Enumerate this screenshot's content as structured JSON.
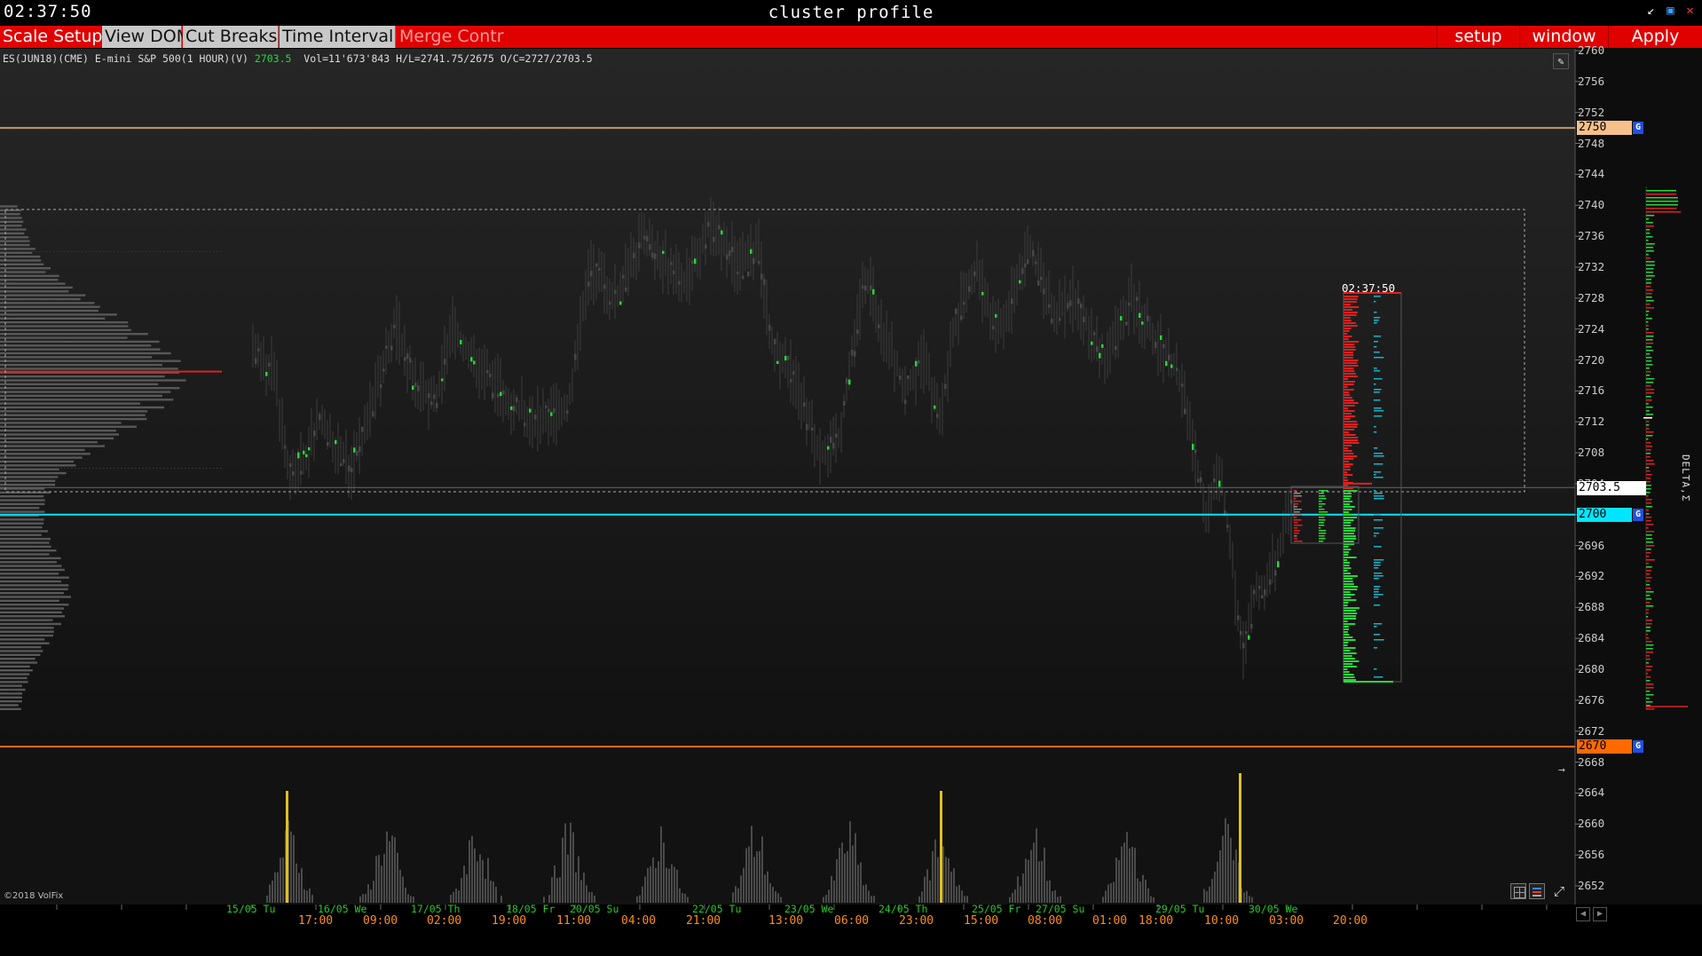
{
  "window": {
    "clock": "02:37:50",
    "title": "cluster profile",
    "controls": [
      "minimize-icon",
      "maximize-icon",
      "close-icon"
    ]
  },
  "toolbar": {
    "left": [
      {
        "label": "Scale Setup",
        "style": "red"
      },
      {
        "label": "View DOM",
        "style": "grey"
      },
      {
        "label": "Cut Breaks",
        "style": "grey"
      },
      {
        "label": "Time Interval",
        "style": "grey"
      },
      {
        "label": "Merge Contr",
        "style": "disabled"
      }
    ],
    "right": [
      "setup",
      "window",
      "Apply"
    ]
  },
  "instrument": {
    "symbol": "ES(JUN18)(CME) E-mini S&P 500(1 HOUR)(V)",
    "last": "2703.5",
    "stats": "Vol=11'673'843 H/L=2741.75/2675 O/C=2727/2703.5"
  },
  "axis": {
    "ticks": [
      "2760",
      "2756",
      "2752",
      "2748",
      "2744",
      "2740",
      "2736",
      "2732",
      "2728",
      "2724",
      "2720",
      "2716",
      "2712",
      "2708",
      "2704",
      "2700",
      "2696",
      "2692",
      "2688",
      "2684",
      "2680",
      "2676",
      "2672",
      "2668",
      "2664",
      "2660",
      "2656",
      "2652"
    ],
    "price_boxes": [
      {
        "label": "2750",
        "tag": "G",
        "bg": "#f5c08a",
        "fg": "#000"
      },
      {
        "label": "2703.5",
        "tag": "",
        "bg": "#ffffff",
        "fg": "#000"
      },
      {
        "label": "2700",
        "tag": "G",
        "bg": "#00e5ff",
        "fg": "#000"
      },
      {
        "label": "2670",
        "tag": "G",
        "bg": "#ff6a00",
        "fg": "#000"
      }
    ]
  },
  "profile_timestamp": "02:37:50",
  "delta_label": "DELTA,Σ",
  "copyright": "©2018 VolFix",
  "dates": [
    "15/05 Tu",
    "16/05 We",
    "17/05 Th",
    "18/05 Fr",
    "20/05 Su",
    "22/05 Tu",
    "23/05 We",
    "24/05 Th",
    "25/05 Fr",
    "27/05 Su",
    "29/05 Tu",
    "30/05 We"
  ],
  "times": [
    "17:00",
    "09:00",
    "02:00",
    "19:00",
    "11:00",
    "04:00",
    "21:00",
    "13:00",
    "06:00",
    "23:00",
    "15:00",
    "08:00",
    "01:00",
    "18:00",
    "10:00",
    "03:00",
    "20:00"
  ],
  "colors": {
    "toolbar": "#e00000",
    "bull": "#27d83a",
    "bear": "#e02020",
    "cyan": "#00e5ff",
    "orange": "#ff6a00",
    "peach": "#f5c08a"
  }
}
